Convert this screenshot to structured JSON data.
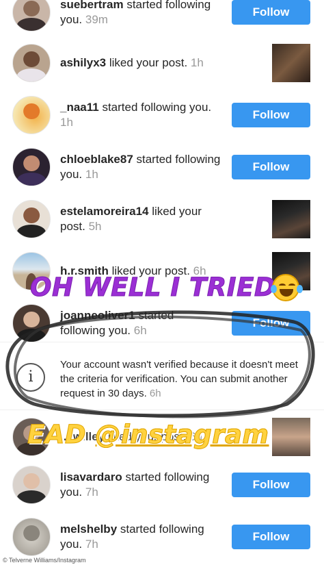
{
  "notifications": [
    {
      "username": "suebertram",
      "action": " started following you.",
      "time": "39m",
      "right": "follow"
    },
    {
      "username": "ashilyx3",
      "action": " liked your post.",
      "time": "1h",
      "right": "thumb"
    },
    {
      "username": "_naa11",
      "action": " started following you.",
      "time": "1h",
      "right": "follow"
    },
    {
      "username": "chloeblake87",
      "action": " started following you.",
      "time": "1h",
      "right": "follow"
    },
    {
      "username": "estelamoreira14",
      "action": " liked your post.",
      "time": "5h",
      "right": "thumb"
    },
    {
      "username": "h.r.smith",
      "action": " liked your post.",
      "time": "6h",
      "right": "thumb"
    },
    {
      "username": "joanneoliver1",
      "action": " started following you.",
      "time": "6h",
      "right": "follow"
    },
    {
      "username": "lisavardaro",
      "action": " started following you.",
      "time": "7h",
      "right": "follow"
    },
    {
      "username": "melshelby",
      "action": " started following you.",
      "time": "7h",
      "right": "follow"
    }
  ],
  "follow_label": "Follow",
  "notice": {
    "text": "Your account wasn't verified because it doesn't meet the criteria for verification. You can submit another request in 30 days.",
    "time": "6h",
    "icon": "info-icon"
  },
  "partial_row": {
    "username": "...iwilley",
    "action": " liked your post.",
    "time": "6h"
  },
  "overlays": {
    "caption1": "OH WELL I TRIED",
    "caption2_prefix": "EAD ",
    "caption2_handle": "@instagram"
  },
  "footer": "© Telverne Williams/Instagram",
  "colors": {
    "follow_button": "#3897f0",
    "caption1": "#9b2fd4",
    "caption2": "#ffd23f",
    "timestamp": "#999999"
  }
}
